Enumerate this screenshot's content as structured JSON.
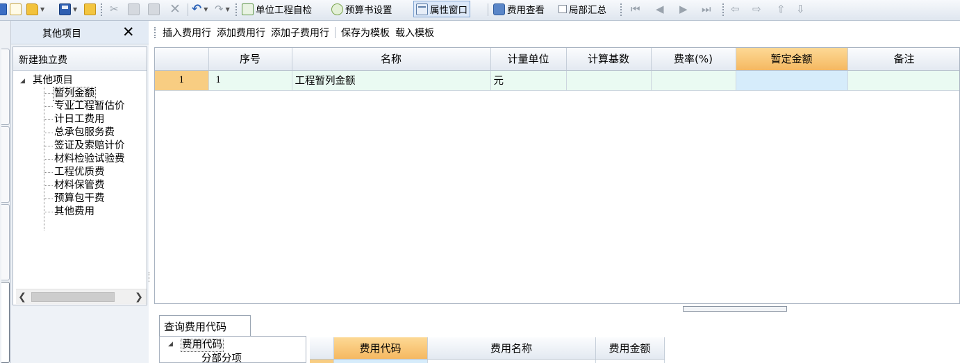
{
  "toolbar": {
    "unit_check": "单位工程自检",
    "budget_settings": "预算书设置",
    "property_window": "属性窗口",
    "fee_view": "费用查看",
    "partial_summary": "局部汇总"
  },
  "side_panel": {
    "title": "其他项目",
    "close_glyph": "✕",
    "tree_header": "新建独立费",
    "tree": {
      "root": "其他项目",
      "items": [
        "暂列金额",
        "专业工程暂估价",
        "计日工费用",
        "总承包服务费",
        "签证及索赔计价",
        "材料检验试验费",
        "工程优质费",
        "材料保管费",
        "预算包干费",
        "其他费用"
      ],
      "selected_index": 0
    }
  },
  "content_toolbar": {
    "insert_row": "插入费用行",
    "add_row": "添加费用行",
    "add_child_row": "添加子费用行",
    "save_template": "保存为模板",
    "load_template": "载入模板"
  },
  "grid": {
    "columns": [
      "",
      "序号",
      "名称",
      "计量单位",
      "计算基数",
      "费率(%)",
      "暂定金额",
      "备注"
    ],
    "highlight_column": 6,
    "rows": [
      {
        "row_num": "1",
        "seq": "1",
        "name": "工程暂列金额",
        "unit": "元",
        "base": "",
        "rate": "",
        "amount": "",
        "note": ""
      }
    ]
  },
  "query": {
    "tab_label": "查询费用代码",
    "tree_root": "费用代码",
    "tree_child": "分部分项",
    "columns": [
      "",
      "费用代码",
      "费用名称",
      "费用金额"
    ]
  }
}
